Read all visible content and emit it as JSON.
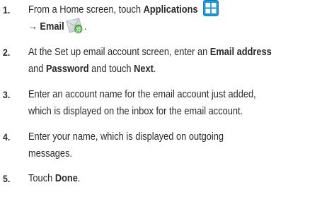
{
  "steps": [
    {
      "number": "1.",
      "segments": [
        {
          "text": "From a Home screen, touch ",
          "bold": false
        },
        {
          "text": "Applications",
          "bold": true
        }
      ],
      "line2": [
        {
          "text": "→ Email",
          "bold": true
        },
        {
          "text": ".",
          "bold": false
        }
      ],
      "icons": [
        "applications-grid-icon",
        "email-envelope-icon"
      ]
    },
    {
      "number": "2.",
      "line1": [
        {
          "text": "At the Set up email account screen, enter an ",
          "bold": false
        },
        {
          "text": "Email address",
          "bold": true
        }
      ],
      "line2": [
        {
          "text": "and ",
          "bold": false
        },
        {
          "text": "Password",
          "bold": true
        },
        {
          "text": " and touch ",
          "bold": false
        },
        {
          "text": "Next",
          "bold": true
        },
        {
          "text": ".",
          "bold": false
        }
      ]
    },
    {
      "number": "3.",
      "line1": "Enter an account name for the email account just added,",
      "line2": "which is displayed on the inbox for the email account."
    },
    {
      "number": "4.",
      "line1": "Enter your name, which is displayed on outgoing",
      "line2": "messages."
    },
    {
      "number": "5.",
      "line1": [
        {
          "text": "Touch ",
          "bold": false
        },
        {
          "text": "Done",
          "bold": true
        },
        {
          "text": ".",
          "bold": false
        }
      ]
    }
  ],
  "colors": {
    "text": "#2a2a2a",
    "apps_icon_blue": "#1e9ad8",
    "email_icon_gray": "#c8ccd0",
    "email_icon_green": "#43a43a"
  }
}
